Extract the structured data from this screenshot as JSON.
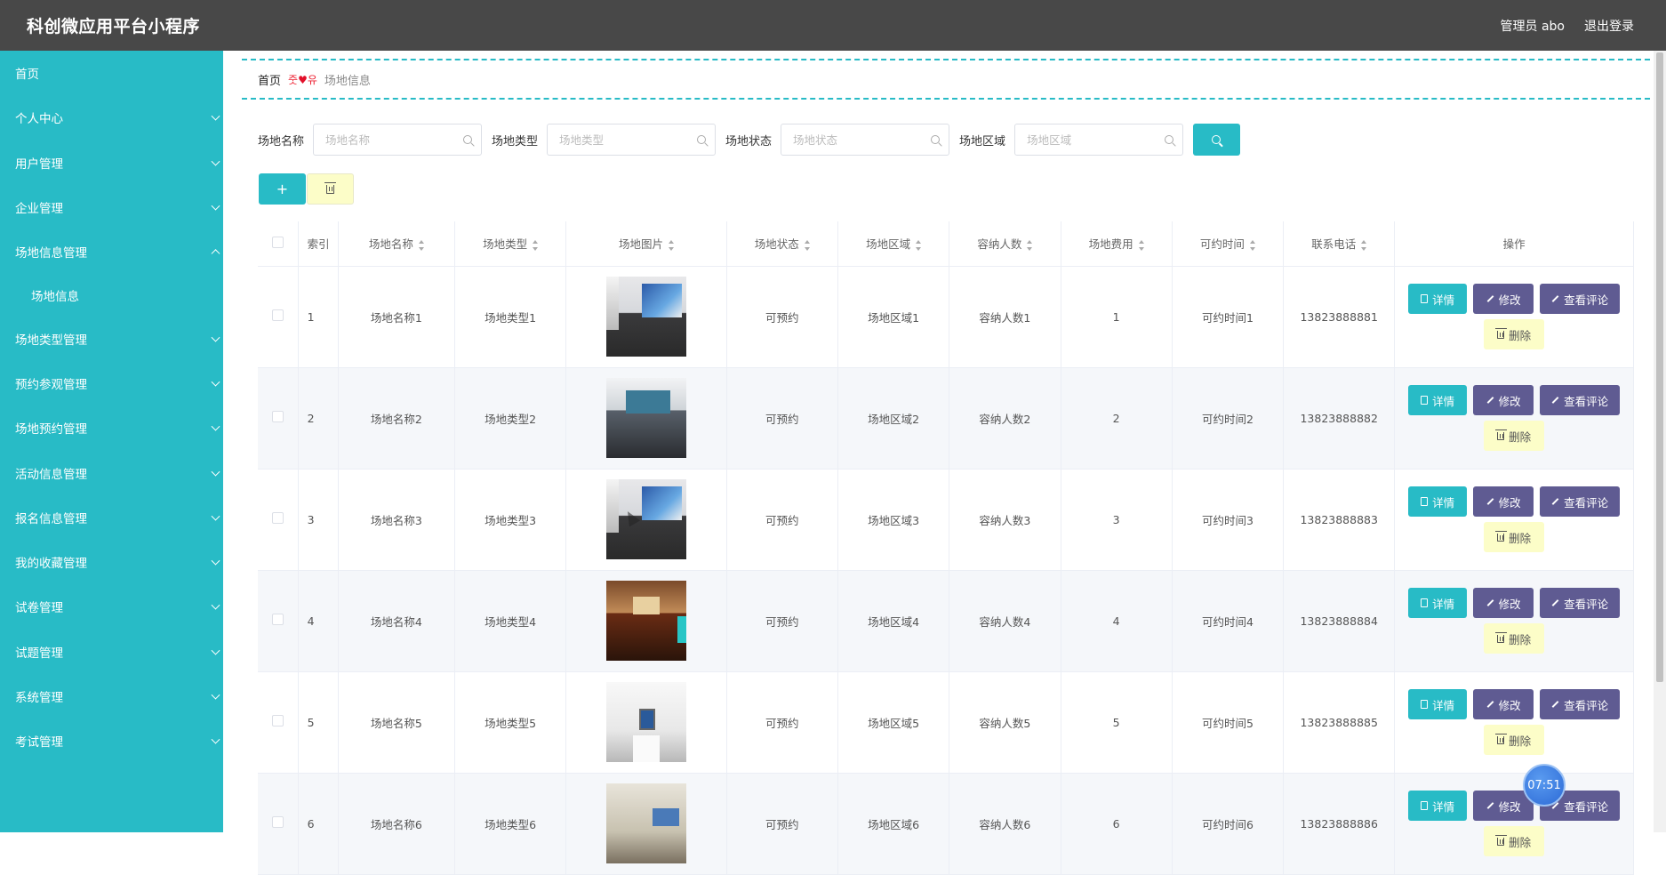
{
  "app": {
    "title": "科创微应用平台小程序"
  },
  "header": {
    "user": "管理员 abo",
    "logout": "退出登录"
  },
  "sidebar": {
    "items": [
      {
        "label": "首页",
        "chevron": "none"
      },
      {
        "label": "个人中心",
        "chevron": "down"
      },
      {
        "label": "用户管理",
        "chevron": "down"
      },
      {
        "label": "企业管理",
        "chevron": "down"
      },
      {
        "label": "场地信息管理",
        "chevron": "up"
      },
      {
        "label": "场地信息",
        "chevron": "none",
        "sub": true
      },
      {
        "label": "场地类型管理",
        "chevron": "down"
      },
      {
        "label": "预约参观管理",
        "chevron": "down"
      },
      {
        "label": "场地预约管理",
        "chevron": "down"
      },
      {
        "label": "活动信息管理",
        "chevron": "down"
      },
      {
        "label": "报名信息管理",
        "chevron": "down"
      },
      {
        "label": "我的收藏管理",
        "chevron": "down"
      },
      {
        "label": "试卷管理",
        "chevron": "down"
      },
      {
        "label": "试题管理",
        "chevron": "down"
      },
      {
        "label": "系统管理",
        "chevron": "down"
      },
      {
        "label": "考试管理",
        "chevron": "down"
      }
    ]
  },
  "breadcrumb": {
    "home": "首页",
    "separator_left": "줏",
    "separator_right": "유",
    "current": "场地信息"
  },
  "search": {
    "fields": [
      {
        "label": "场地名称",
        "placeholder": "场地名称"
      },
      {
        "label": "场地类型",
        "placeholder": "场地类型"
      },
      {
        "label": "场地状态",
        "placeholder": "场地状态"
      },
      {
        "label": "场地区域",
        "placeholder": "场地区域"
      }
    ]
  },
  "actions": {
    "add_label": "+"
  },
  "table": {
    "columns": [
      "索引",
      "场地名称",
      "场地类型",
      "场地图片",
      "场地状态",
      "场地区域",
      "容纳人数",
      "场地费用",
      "可约时间",
      "联系电话",
      "操作"
    ],
    "rows": [
      {
        "index": "1",
        "name": "场地名称1",
        "type": "场地类型1",
        "image": "meeting-room-a",
        "status": "可预约",
        "area": "场地区域1",
        "capacity": "容纳人数1",
        "fee": "1",
        "time": "可约时间1",
        "phone": "13823888881"
      },
      {
        "index": "2",
        "name": "场地名称2",
        "type": "场地类型2",
        "image": "meeting-room-b",
        "status": "可预约",
        "area": "场地区域2",
        "capacity": "容纳人数2",
        "fee": "2",
        "time": "可约时间2",
        "phone": "13823888882"
      },
      {
        "index": "3",
        "name": "场地名称3",
        "type": "场地类型3",
        "image": "meeting-room-a",
        "status": "可预约",
        "area": "场地区域3",
        "capacity": "容纳人数3",
        "fee": "3",
        "time": "可约时间3",
        "phone": "13823888883"
      },
      {
        "index": "4",
        "name": "场地名称4",
        "type": "场地类型4",
        "image": "meeting-room-c",
        "status": "可预约",
        "area": "场地区域4",
        "capacity": "容纳人数4",
        "fee": "4",
        "time": "可约时间4",
        "phone": "13823888884"
      },
      {
        "index": "5",
        "name": "场地名称5",
        "type": "场地类型5",
        "image": "meeting-room-d",
        "status": "可预约",
        "area": "场地区域5",
        "capacity": "容纳人数5",
        "fee": "5",
        "time": "可约时间5",
        "phone": "13823888885"
      },
      {
        "index": "6",
        "name": "场地名称6",
        "type": "场地类型6",
        "image": "meeting-room-e",
        "status": "可预约",
        "area": "场地区域6",
        "capacity": "容纳人数6",
        "fee": "6",
        "time": "可约时间6",
        "phone": "13823888886"
      }
    ],
    "row_actions": {
      "detail": "详情",
      "edit": "修改",
      "comment": "查看评论",
      "delete": "删除"
    }
  },
  "timer": {
    "text": "07:51"
  },
  "colors": {
    "accent": "#28bbc6",
    "topbar": "#484848",
    "purple_button": "#5f5b92",
    "delete_button": "#fcfdc8"
  },
  "icons": {
    "search": "search-icon",
    "trash": "trash-icon",
    "chevron": "chevron-icon",
    "heart": "heart-icon"
  }
}
